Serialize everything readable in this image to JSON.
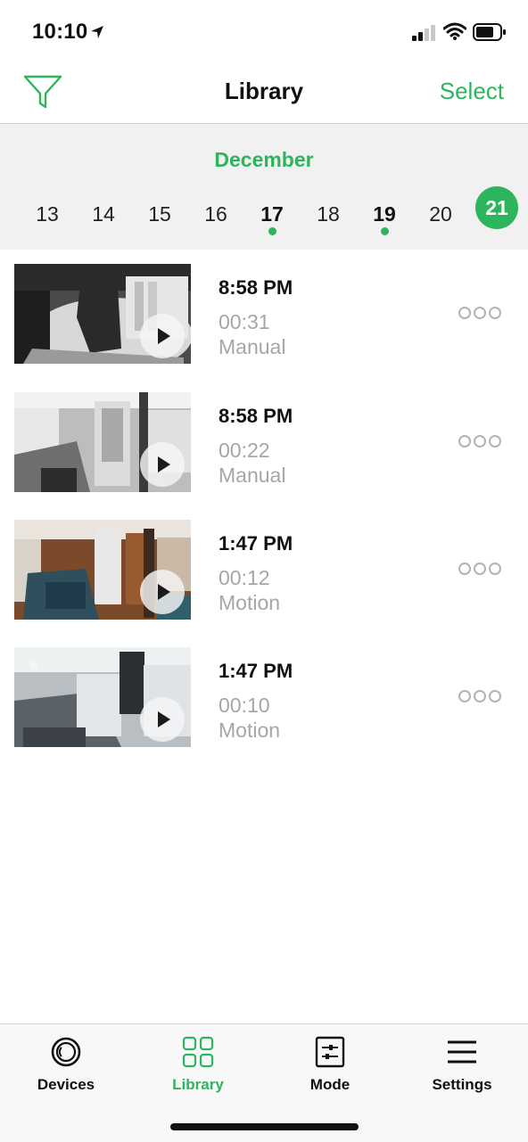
{
  "status_bar": {
    "time": "10:10",
    "icons": [
      "location-arrow-icon",
      "cellular-signal-icon",
      "wifi-icon",
      "battery-icon"
    ]
  },
  "nav": {
    "title": "Library",
    "select_label": "Select",
    "filter_icon": "filter-funnel-icon"
  },
  "calendar": {
    "month": "December",
    "days": [
      {
        "label": "13",
        "has_recordings": false,
        "selected": false
      },
      {
        "label": "14",
        "has_recordings": false,
        "selected": false
      },
      {
        "label": "15",
        "has_recordings": false,
        "selected": false
      },
      {
        "label": "16",
        "has_recordings": false,
        "selected": false
      },
      {
        "label": "17",
        "has_recordings": true,
        "selected": false
      },
      {
        "label": "18",
        "has_recordings": false,
        "selected": false
      },
      {
        "label": "19",
        "has_recordings": true,
        "selected": false
      },
      {
        "label": "20",
        "has_recordings": false,
        "selected": false
      },
      {
        "label": "21",
        "has_recordings": false,
        "selected": true
      }
    ]
  },
  "clips": [
    {
      "time": "8:58 PM",
      "duration": "00:31",
      "trigger": "Manual"
    },
    {
      "time": "8:58 PM",
      "duration": "00:22",
      "trigger": "Manual"
    },
    {
      "time": "1:47 PM",
      "duration": "00:12",
      "trigger": "Motion"
    },
    {
      "time": "1:47 PM",
      "duration": "00:10",
      "trigger": "Motion"
    }
  ],
  "tabs": [
    {
      "label": "Devices",
      "icon": "devices-camera-icon",
      "active": false
    },
    {
      "label": "Library",
      "icon": "library-grid-icon",
      "active": true
    },
    {
      "label": "Mode",
      "icon": "mode-sliders-icon",
      "active": false
    },
    {
      "label": "Settings",
      "icon": "settings-menu-icon",
      "active": false
    }
  ],
  "colors": {
    "accent": "#2db55d",
    "background": "#ffffff",
    "date_strip_bg": "#f1f1f1",
    "secondary_text": "#a6a6a6"
  }
}
